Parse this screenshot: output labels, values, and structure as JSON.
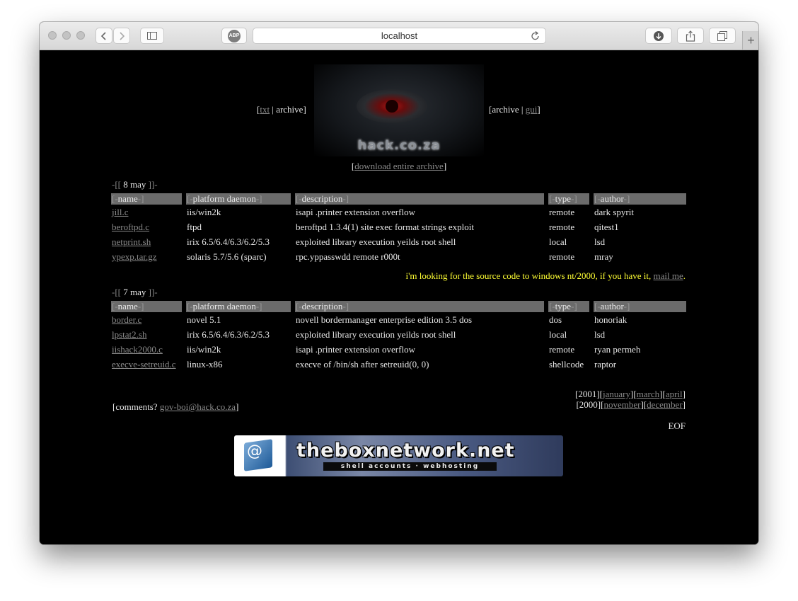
{
  "browser": {
    "url": "localhost",
    "adblock_label": "ABP",
    "newtab_label": "+"
  },
  "logo": {
    "text": "hack.co.za"
  },
  "nav": {
    "left_txt": "txt",
    "left_archive": "archive",
    "right_archive": "archive",
    "right_gui": "gui",
    "download": "download entire archive"
  },
  "headers": {
    "name": "name",
    "platform": "platform daemon",
    "description": "description",
    "type": "type",
    "author": "author"
  },
  "sections": [
    {
      "date": "8 may",
      "rows": [
        {
          "name": "jill.c",
          "platform": "iis/win2k",
          "description": "isapi .printer extension overflow",
          "type": "remote",
          "author": "dark spyrit"
        },
        {
          "name": "beroftpd.c",
          "platform": "ftpd",
          "description": "beroftpd 1.3.4(1) site exec format strings exploit",
          "type": "remote",
          "author": "qitest1"
        },
        {
          "name": "netprint.sh",
          "platform": "irix 6.5/6.4/6.3/6.2/5.3",
          "description": "exploited library execution yeilds root shell",
          "type": "local",
          "author": "lsd"
        },
        {
          "name": "ypexp.tar.gz",
          "platform": "solaris 5.7/5.6 (sparc)",
          "description": "rpc.yppasswdd remote r000t",
          "type": "remote",
          "author": "mray"
        }
      ]
    },
    {
      "date": "7 may",
      "rows": [
        {
          "name": "border.c",
          "platform": "novel 5.1",
          "description": "novell bordermanager enterprise edition 3.5 dos",
          "type": "dos",
          "author": "honoriak"
        },
        {
          "name": "lpstat2.sh",
          "platform": "irix 6.5/6.4/6.3/6.2/5.3",
          "description": "exploited library execution yeilds root shell",
          "type": "local",
          "author": "lsd"
        },
        {
          "name": "iishack2000.c",
          "platform": "iis/win2k",
          "description": "isapi .printer extension overflow",
          "type": "remote",
          "author": "ryan permeh"
        },
        {
          "name": "execve-setreuid.c",
          "platform": "linux-x86",
          "description": "execve of /bin/sh after setreuid(0, 0)",
          "type": "shellcode",
          "author": "raptor"
        }
      ]
    }
  ],
  "note": {
    "text": "i'm looking for the source code to windows nt/2000, if you have it,",
    "link": "mail me"
  },
  "footer": {
    "comments_label": "comments?",
    "email": "gov-boi@hack.co.za",
    "year1": "2001",
    "months1": [
      "january",
      "march",
      "april"
    ],
    "year2": "2000",
    "months2": [
      "november",
      "december"
    ],
    "eof": "EOF"
  },
  "banner": {
    "name": "theboxnetwork.net",
    "tagline": "shell accounts · webhosting"
  },
  "colors": {
    "page_bg": "#000000",
    "header_bg": "#6b6b6b",
    "link": "#8a8a8a",
    "note": "#ffff33"
  }
}
